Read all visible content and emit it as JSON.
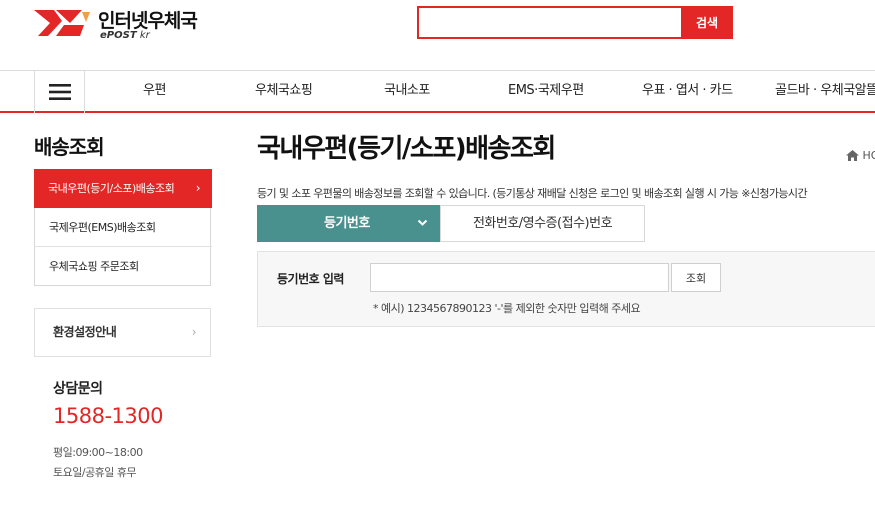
{
  "header": {
    "logo_name": "인터넷우체국",
    "logo_sub_brand": "ePOST",
    "logo_sub_domain": "kr",
    "search": {
      "placeholder": "",
      "value": "",
      "button_label": "검색"
    }
  },
  "gnb": {
    "items": [
      {
        "label": "우편"
      },
      {
        "label": "우체국쇼핑"
      },
      {
        "label": "국내소포"
      },
      {
        "label": "EMS·국제우편"
      },
      {
        "label": "우표 · 엽서 · 카드"
      },
      {
        "label": "골드바 · 우체국알뜰"
      }
    ]
  },
  "sidebar": {
    "title": "배송조회",
    "items": [
      {
        "label": "국내우편(등기/소포)배송조회",
        "active": true
      },
      {
        "label": "국제우편(EMS)배송조회"
      },
      {
        "label": "우체국쇼핑 주문조회"
      }
    ],
    "env_setting": "환경설정안내",
    "contact": {
      "title": "상담문의",
      "phone": "1588-1300",
      "weekday_hours": "평일:09:00~18:00",
      "weekend": "토요일/공휴일 휴무"
    }
  },
  "main": {
    "title": "국내우편(등기/소포)배송조회",
    "breadcrumb_home": "HO",
    "description": "등기 및 소포 우편물의 배송정보를 조회할 수 있습니다. (등기통상 재배달 신청은 로그인 및 배송조회 실행 시 가능 ※신청가능시간",
    "tabs": [
      {
        "label": "등기번호",
        "active": true
      },
      {
        "label": "전화번호/영수증(접수)번호"
      }
    ],
    "form": {
      "label": "등기번호 입력",
      "input_value": "",
      "button_label": "조회",
      "hint": "* 예시) 1234567890123 '-'를 제외한 숫자만 입력해 주세요"
    }
  },
  "colors": {
    "brand_red": "#e32726",
    "tab_teal": "#49918e"
  },
  "icons": [
    "epost-logo-icon",
    "hamburger-menu-icon",
    "chevron-right-icon",
    "chevron-down-icon",
    "home-icon"
  ]
}
